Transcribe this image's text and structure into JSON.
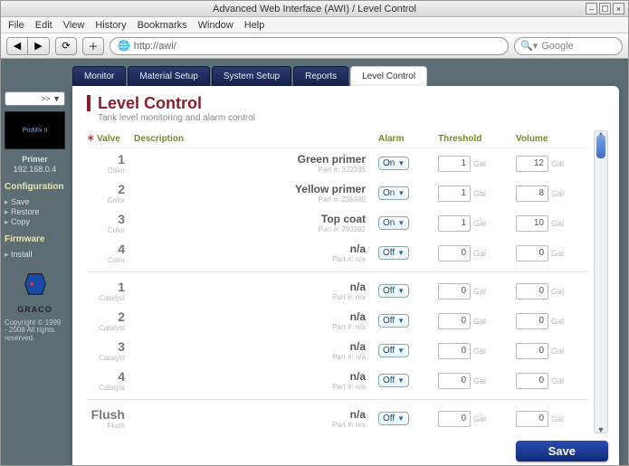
{
  "window": {
    "title": "Advanced Web Interface (AWI) / Level Control"
  },
  "menubar": [
    "File",
    "Edit",
    "View",
    "History",
    "Bookmarks",
    "Window",
    "Help"
  ],
  "toolbar": {
    "url_scheme_icon": "🌐",
    "url": "http://awi/",
    "search_placeholder": "Google"
  },
  "sidebar": {
    "selector_label": ">>",
    "thumb_text": "ProMix II",
    "thumb_caption_line1": "Primer",
    "thumb_caption_line2": "192.168.0.4",
    "config_title": "Configuration",
    "config_links": [
      "Save",
      "Restore",
      "Copy"
    ],
    "fw_title": "Firmware",
    "fw_links": [
      "Install"
    ],
    "brand": "GRACO",
    "copyright": "Copyright © 1999 - 2008\nAll rights reserved."
  },
  "tabs": [
    "Monitor",
    "Material Setup",
    "System Setup",
    "Reports",
    "Level Control"
  ],
  "active_tab_index": 4,
  "page": {
    "title": "Level Control",
    "subtitle": "Tank level monitoring and alarm control",
    "columns": {
      "valve": "Valve",
      "description": "Description",
      "alarm": "Alarm",
      "threshold": "Threshold",
      "volume": "Volume"
    },
    "unit": "Gal"
  },
  "rows": [
    {
      "num": "1",
      "type": "Color",
      "desc": "Green primer",
      "part": "Part #: 322335",
      "alarm": "On",
      "threshold": "1",
      "volume": "12"
    },
    {
      "num": "2",
      "type": "Color",
      "desc": "Yellow primer",
      "part": "Part #: 236989",
      "alarm": "On",
      "threshold": "1",
      "volume": "8"
    },
    {
      "num": "3",
      "type": "Color",
      "desc": "Top coat",
      "part": "Part #: 293392",
      "alarm": "On",
      "threshold": "1",
      "volume": "10"
    },
    {
      "num": "4",
      "type": "Color",
      "desc": "n/a",
      "part": "Part #: n/a",
      "alarm": "Off",
      "threshold": "0",
      "volume": "0"
    },
    {
      "sep": true
    },
    {
      "num": "1",
      "type": "Catalyst",
      "desc": "n/a",
      "part": "Part #: n/a",
      "alarm": "Off",
      "threshold": "0",
      "volume": "0"
    },
    {
      "num": "2",
      "type": "Catalyst",
      "desc": "n/a",
      "part": "Part #: n/a",
      "alarm": "Off",
      "threshold": "0",
      "volume": "0"
    },
    {
      "num": "3",
      "type": "Catalyst",
      "desc": "n/a",
      "part": "Part #: n/a",
      "alarm": "Off",
      "threshold": "0",
      "volume": "0"
    },
    {
      "num": "4",
      "type": "Catalyst",
      "desc": "n/a",
      "part": "Part #: n/a",
      "alarm": "Off",
      "threshold": "0",
      "volume": "0"
    },
    {
      "sep": true
    },
    {
      "num": "Flush",
      "type": "Flush",
      "desc": "n/a",
      "part": "Part #: n/a",
      "alarm": "Off",
      "threshold": "0",
      "volume": "0"
    }
  ],
  "actions": {
    "save": "Save"
  }
}
